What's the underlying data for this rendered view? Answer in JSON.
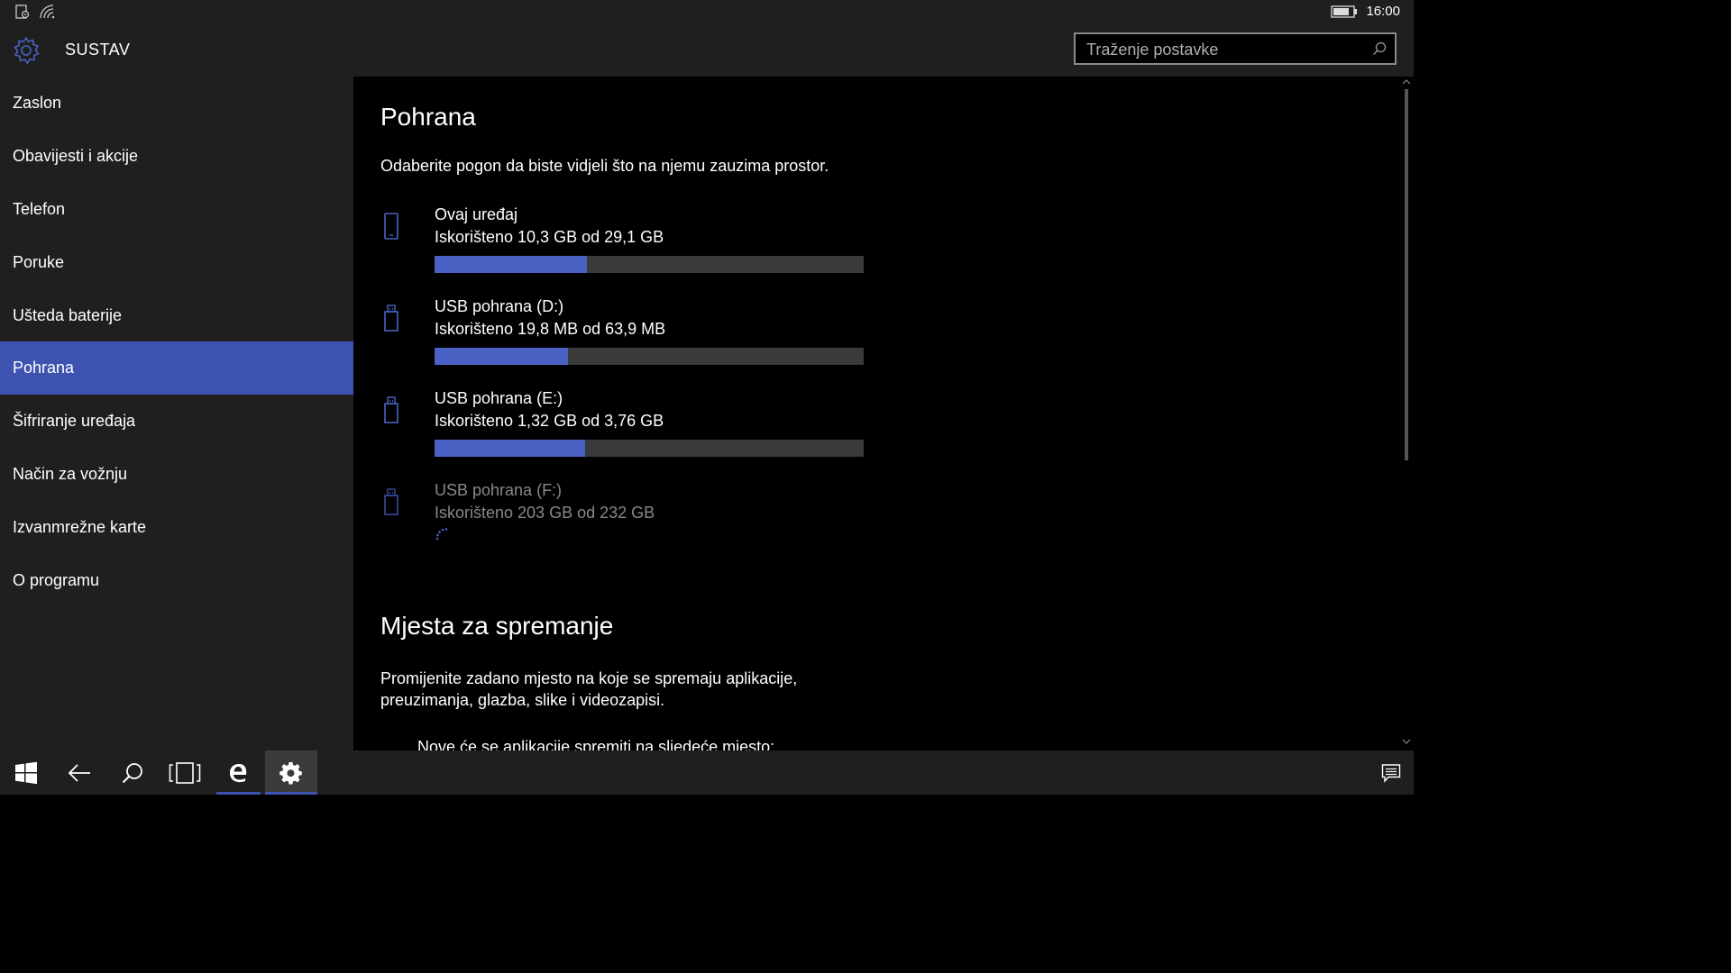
{
  "status": {
    "time": "16:00",
    "icons": [
      "notification-icon",
      "wifi-signal-icon",
      "battery-icon"
    ]
  },
  "header": {
    "title": "SUSTAV",
    "search_placeholder": "Traženje postavke"
  },
  "sidebar": {
    "items": [
      {
        "label": "Zaslon"
      },
      {
        "label": "Obavijesti i akcije"
      },
      {
        "label": "Telefon"
      },
      {
        "label": "Poruke"
      },
      {
        "label": "Ušteda baterije"
      },
      {
        "label": "Pohrana",
        "selected": true
      },
      {
        "label": "Šifriranje uređaja"
      },
      {
        "label": "Način za vožnju"
      },
      {
        "label": "Izvanmrežne karte"
      },
      {
        "label": "O programu"
      }
    ]
  },
  "main": {
    "title": "Pohrana",
    "intro": "Odaberite pogon da biste vidjeli što na njemu zauzima prostor.",
    "drives": [
      {
        "name": "Ovaj uređaj",
        "usage": "Iskorišteno 10,3 GB od 29,1 GB",
        "used_fraction": 0.354,
        "icon": "phone-icon"
      },
      {
        "name": "USB pohrana (D:)",
        "usage": "Iskorišteno 19,8 MB od 63,9 MB",
        "used_fraction": 0.31,
        "icon": "usb-drive-icon"
      },
      {
        "name": "USB pohrana (E:)",
        "usage": "Iskorišteno 1,32 GB od 3,76 GB",
        "used_fraction": 0.351,
        "icon": "usb-drive-icon"
      },
      {
        "name": "USB pohrana (F:)",
        "usage": "Iskorišteno 203 GB od 232 GB",
        "loading": true,
        "icon": "usb-drive-icon"
      }
    ],
    "save_locations": {
      "title": "Mjesta za spremanje",
      "description": "Promijenite zadano mjesto na koje se spremaju aplikacije, preuzimanja, glazba, slike i videozapisi.",
      "new_apps_label": "Nove će se aplikacije spremiti na sljedeće mjesto:"
    }
  },
  "taskbar": {
    "items": [
      "start-icon",
      "back-arrow-icon",
      "search-icon",
      "task-view-icon",
      "edge-icon",
      "settings-gear-icon"
    ],
    "active": "settings-gear-icon",
    "tray": [
      "action-center-icon"
    ]
  },
  "colors": {
    "accent": "#3e53b0",
    "bar_fill": "#4a61c4",
    "bar_track": "#3a3a3a",
    "chrome": "#1f1f1f",
    "background": "#000000"
  }
}
